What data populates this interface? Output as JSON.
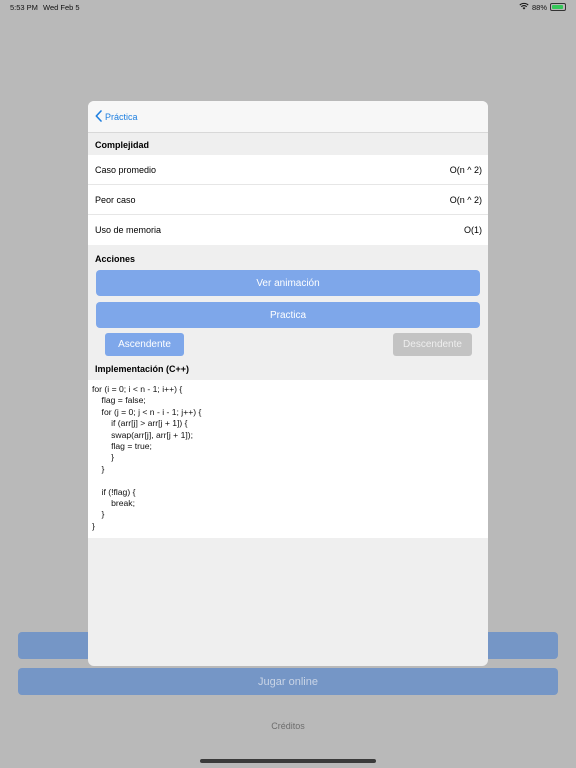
{
  "status_bar": {
    "time": "5:53 PM",
    "date": "Wed Feb 5",
    "battery": "88%",
    "battery_level": 0.88
  },
  "background": {
    "play_online_label": "Jugar online",
    "credits_label": "Créditos"
  },
  "modal": {
    "back_label": "Práctica",
    "complexity": {
      "header": "Complejidad",
      "rows": [
        {
          "label": "Caso promedio",
          "value": "O(n ^ 2)"
        },
        {
          "label": "Peor caso",
          "value": "O(n ^ 2)"
        },
        {
          "label": "Uso de memoria",
          "value": "O(1)"
        }
      ]
    },
    "actions": {
      "header": "Acciones",
      "view_animation_label": "Ver animación",
      "practice_label": "Practica",
      "ascending_label": "Ascendente",
      "descending_label": "Descendente"
    },
    "implementation": {
      "header": "Implementación (C++)",
      "code": "for (i = 0; i < n - 1; i++) {\n    flag = false;\n    for (j = 0; j < n - i - 1; j++) {\n        if (arr[j] > arr[j + 1]) {\n        swap(arr[j], arr[j + 1]);\n        flag = true;\n        }\n    }\n\n    if (!flag) {\n        break;\n    }\n}"
    }
  },
  "colors": {
    "accent": "#1e7fe0",
    "button": "#7ea7ea",
    "button_disabled": "#c3c3c3"
  }
}
